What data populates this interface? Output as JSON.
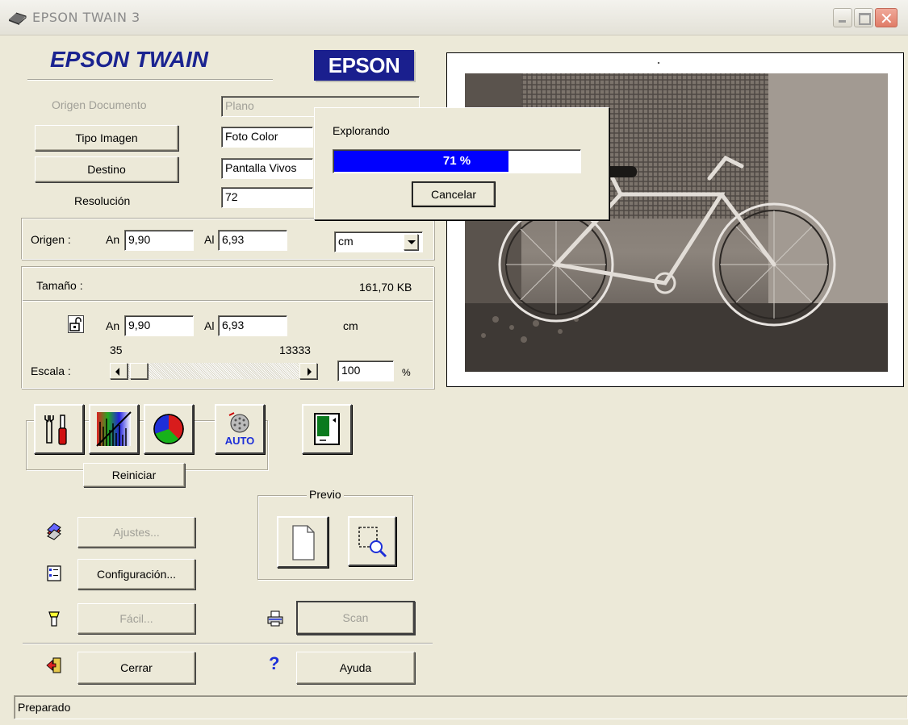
{
  "window": {
    "title": "EPSON TWAIN 3"
  },
  "header": {
    "app_logo": "EPSON TWAIN",
    "brand_logo": "EPSON"
  },
  "settings": {
    "document_source": {
      "label": "Origen Documento",
      "value": "Plano"
    },
    "image_type": {
      "label": "Tipo Imagen",
      "value": "Foto Color"
    },
    "destination": {
      "label": "Destino",
      "value": "Pantalla Vivos"
    },
    "resolution": {
      "label": "Resolución",
      "value": "72"
    }
  },
  "origin": {
    "label": "Origen :",
    "width_label": "An",
    "width_value": "9,90",
    "height_label": "Al",
    "height_value": "6,93",
    "unit": "cm"
  },
  "size": {
    "label": "Tamaño :",
    "file_size": "161,70 KB",
    "width_label": "An",
    "width_value": "9,90",
    "height_label": "Al",
    "height_value": "6,93",
    "unit": "cm",
    "scale_label": "Escala :",
    "scale_min": "35",
    "scale_max": "13333",
    "scale_value": "100",
    "scale_unit": "%"
  },
  "tools": {
    "reset_label": "Reiniciar",
    "auto_label": "AUTO"
  },
  "actions": {
    "settings_label": "Ajustes...",
    "configuration_label": "Configuración...",
    "easy_label": "Fácil...",
    "scan_label": "Scan",
    "close_label": "Cerrar",
    "help_label": "Ayuda"
  },
  "preview": {
    "group_label": "Previo"
  },
  "progress_dialog": {
    "title": "Explorando",
    "percent_text": "71 %",
    "progress_fraction": 0.71,
    "cancel_label": "Cancelar"
  },
  "status": {
    "text": "Preparado"
  },
  "colors": {
    "window_bg": "#ECE9D8",
    "logo_blue": "#1a2390",
    "progress_blue": "#0000ff"
  }
}
